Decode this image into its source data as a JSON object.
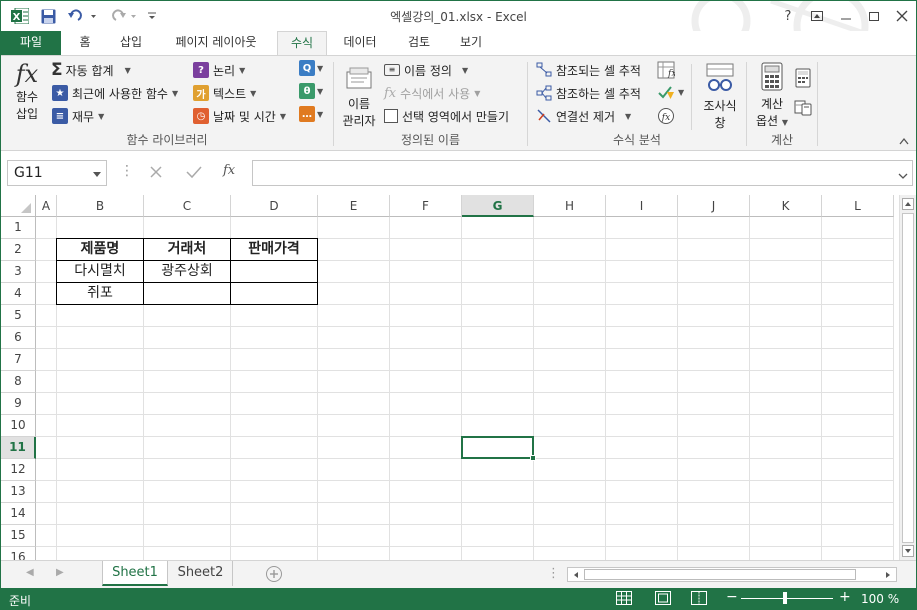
{
  "window": {
    "title": "엑셀강의_01.xlsx - Excel",
    "help": "?",
    "accent": "#217346"
  },
  "qat": {
    "app_icon": "excel-icon",
    "save": "save-icon",
    "undo": "undo-icon",
    "redo": "redo-icon"
  },
  "tabs": [
    {
      "label": "파일"
    },
    {
      "label": "홈"
    },
    {
      "label": "삽입"
    },
    {
      "label": "페이지 레이아웃"
    },
    {
      "label": "수식"
    },
    {
      "label": "데이터"
    },
    {
      "label": "검토"
    },
    {
      "label": "보기"
    }
  ],
  "ribbon": {
    "function_library": {
      "label": "함수 라이브러리",
      "insert_function_line1": "함수",
      "insert_function_line2": "삽입",
      "autosum": "자동 합계",
      "recent": "최근에 사용한 함수",
      "financial": "재무",
      "logical": "논리",
      "text": "텍스트",
      "datetime": "날짜 및 시간"
    },
    "defined_names": {
      "label": "정의된 이름",
      "name_manager_line1": "이름",
      "name_manager_line2": "관리자",
      "define_name": "이름 정의",
      "use_in_formula": "수식에서 사용",
      "create_from_selection": "선택 영역에서 만들기"
    },
    "formula_auditing": {
      "label": "수식 분석",
      "trace_precedents": "참조되는 셀 추적",
      "trace_dependents": "참조하는 셀 추적",
      "remove_arrows": "연결선 제거",
      "watch_line1": "조사식",
      "watch_line2": "창"
    },
    "calculation": {
      "label": "계산",
      "options_line1": "계산",
      "options_line2": "옵션"
    }
  },
  "formula_bar": {
    "name_box": "G11",
    "fx": "fx",
    "value": ""
  },
  "columns": [
    "A",
    "B",
    "C",
    "D",
    "E",
    "F",
    "G",
    "H",
    "I",
    "J",
    "K",
    "L"
  ],
  "rows": [
    "1",
    "2",
    "3",
    "4",
    "5",
    "6",
    "7",
    "8",
    "9",
    "10",
    "11",
    "12",
    "13",
    "14",
    "15",
    "16"
  ],
  "selected": {
    "col": "G",
    "row": "11"
  },
  "cells": {
    "B2": "제품명",
    "C2": "거래처",
    "D2": "판매가격",
    "B3": "다시멸치",
    "C3": "광주상회",
    "B4": "쥐포"
  },
  "sheets": [
    {
      "label": "Sheet1"
    },
    {
      "label": "Sheet2"
    }
  ],
  "status": {
    "ready": "준비",
    "zoom": "100 %"
  }
}
